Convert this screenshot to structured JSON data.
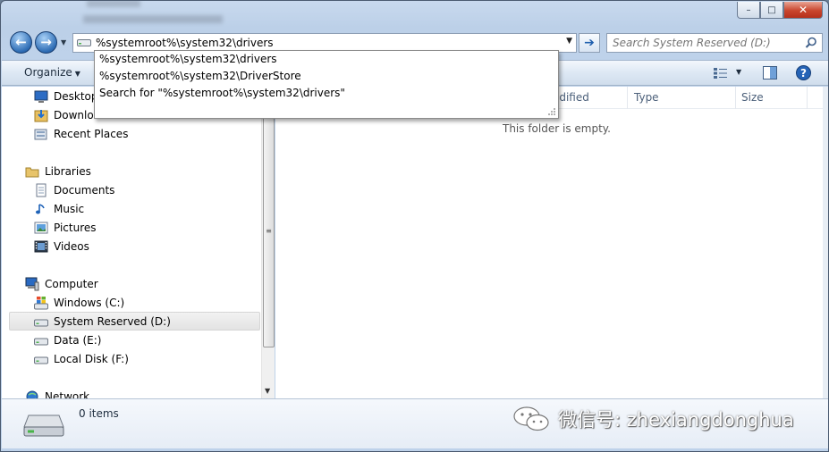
{
  "titlebar": {
    "blur_line1": "",
    "blur_line2": "",
    "minimize": "–",
    "maximize": "□",
    "close": "✕"
  },
  "address": {
    "value": "%systemroot%\\system32\\drivers",
    "suggestions": [
      "%systemroot%\\system32\\drivers",
      "%systemroot%\\system32\\DriverStore",
      "Search for \"%systemroot%\\system32\\drivers\""
    ]
  },
  "search": {
    "placeholder": "Search System Reserved (D:)"
  },
  "toolbar": {
    "organize": "Organize"
  },
  "nav": {
    "favorites": [
      {
        "label": "Desktop",
        "icon": "desktop-icon"
      },
      {
        "label": "Downloads",
        "icon": "downloads-icon"
      },
      {
        "label": "Recent Places",
        "icon": "recent-places-icon"
      }
    ],
    "libraries_label": "Libraries",
    "libraries": [
      {
        "label": "Documents",
        "icon": "documents-icon"
      },
      {
        "label": "Music",
        "icon": "music-icon"
      },
      {
        "label": "Pictures",
        "icon": "pictures-icon"
      },
      {
        "label": "Videos",
        "icon": "videos-icon"
      }
    ],
    "computer_label": "Computer",
    "drives": [
      {
        "label": "Windows (C:)",
        "icon": "windows-drive-icon"
      },
      {
        "label": "System Reserved (D:)",
        "icon": "drive-icon",
        "selected": true
      },
      {
        "label": "Data (E:)",
        "icon": "drive-icon"
      },
      {
        "label": "Local Disk (F:)",
        "icon": "drive-icon"
      }
    ],
    "network_label": "Network"
  },
  "columns": {
    "modified": "odified",
    "type": "Type",
    "size": "Size"
  },
  "content": {
    "empty_message": "This folder is empty."
  },
  "details": {
    "item_count": "0 items"
  },
  "watermark": {
    "text": "微信号: zhexiangdonghua"
  },
  "colors": {
    "accent": "#2e6db5",
    "window_frame": "#bed2ea",
    "selection": "#e3e3e3"
  }
}
